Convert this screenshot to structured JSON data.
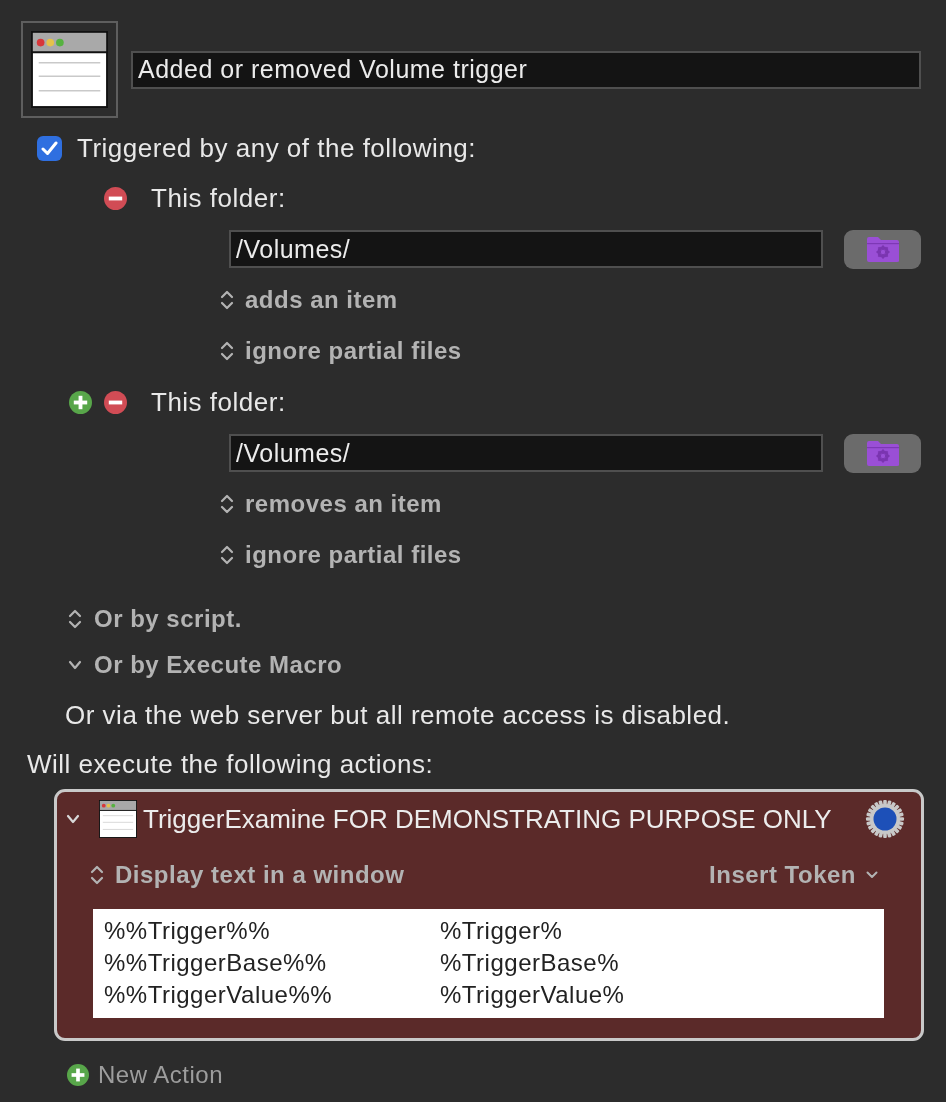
{
  "macro": {
    "name": "Added or removed Volume trigger"
  },
  "trigger_group": {
    "label": "Triggered by any of the following:",
    "checked": true
  },
  "folder_triggers": [
    {
      "add_button": false,
      "label": "This folder:",
      "path": "/Volumes/",
      "event": "adds an item",
      "option": "ignore partial files"
    },
    {
      "add_button": true,
      "label": "This folder:",
      "path": "/Volumes/",
      "event": "removes an item",
      "option": "ignore partial files"
    }
  ],
  "other_triggers": [
    {
      "kind": "popup",
      "label": "Or by script."
    },
    {
      "kind": "disclosure",
      "label": "Or by Execute Macro",
      "expanded": true
    }
  ],
  "web_server_note": "Or via the web server but all remote access is disabled.",
  "actions_heading": "Will execute the following actions:",
  "actions": [
    {
      "expanded": true,
      "title": "TriggerExamine FOR DEMONSTRATING PURPOSE ONLY",
      "action_type": "Display text in a window",
      "token_menu": "Insert Token",
      "text_lines": [
        [
          "%%Trigger%%",
          "%Trigger%"
        ],
        [
          "%%TriggerBase%%",
          "%TriggerBase%"
        ],
        [
          "%%TriggerValue%%",
          "%TriggerValue%"
        ]
      ]
    }
  ],
  "new_action": "New Action"
}
